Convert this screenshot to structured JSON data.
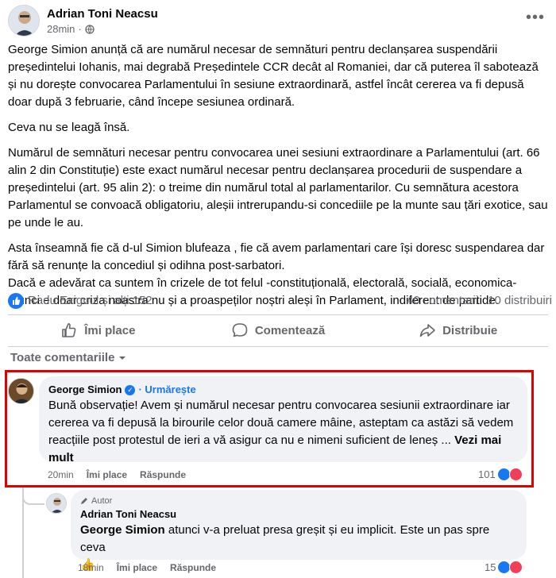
{
  "post": {
    "author": "Adrian Toni Neacsu",
    "time": "28min",
    "visibility_icon": "globe-icon",
    "paragraphs": [
      "George Simion anunță că are numărul necesar de semnături pentru declanșarea suspendării președintelui Iohanis, mai degrabă Președintele CCR decât al Romaniei, dar că puterea îl sabotează și nu dorește convocarea Parlamentului în sesiune extraordinară, astfel încât cererea va fi depusă doar după 3 februarie, când începe sesiunea ordinară.",
      "Ceva nu se leagă însă.",
      "Numărul de semnături necesar pentru convocarea unei sesiuni extraordinare a Parlamentului (art. 66 alin 2 din Constituție) este exact numărul necesar pentru declanșarea procedurii de suspendare a președintelui (art. 95 alin 2): o treime din numărul total al parlamentarilor. Cu semnătura acestora Parlamentul se convoacă obligatoriu, aleșii intrerupandu-si concediile pe la munte sau țări exotice, sau pe unde le au.",
      "Asta înseamnă fie că d-ul Simion blufeaza , fie că avem parlamentari care își doresc suspendarea dar fără să renunțe la concediul și odihna post-sarbatori.\nDacă e adevărat ca suntem în crizele de tot felul -constituțională, electorală, socială, economica- atunci e doar criza noastra nu și a proaspeților noștri aleși în Parlament, indiferent de partide."
    ],
    "reactions_text": "Radu Exiguul și alți 152",
    "comments_count": "40 comentarii",
    "shares_count": "10 distribuiri"
  },
  "actions": {
    "like": "Îmi place",
    "comment": "Comentează",
    "share": "Distribuie"
  },
  "comments_filter": "Toate comentariile",
  "comment1": {
    "author": "George Simion",
    "follow": "· Urmărește",
    "text": "Bună observație! Avem și numărul necesar pentru convocarea sesiunii extraordinare iar cererea va fi depusă la birourile celor două camere mâine, asteptam ca astăzi să vedem reacțiile post protestul de ieri a vă asigur ca nu e nimeni suficient de leneș ... ",
    "see_more": "Vezi mai mult",
    "time": "20min",
    "like": "Îmi place",
    "reply": "Răspunde",
    "reaction_count": "101"
  },
  "comment2": {
    "badge": "Autor",
    "author": "Adrian Toni Neacsu",
    "mention": "George Simion",
    "text": " atunci v-a preluat presa greșit și eu implicit. Este un pas spre ceva",
    "emoji": "👍",
    "time": "18min",
    "like": "Îmi place",
    "reply": "Răspunde",
    "reaction_count": "15"
  },
  "colors": {
    "accent": "#1877f2",
    "highlight": "#e00000",
    "love": "#f33e58"
  }
}
